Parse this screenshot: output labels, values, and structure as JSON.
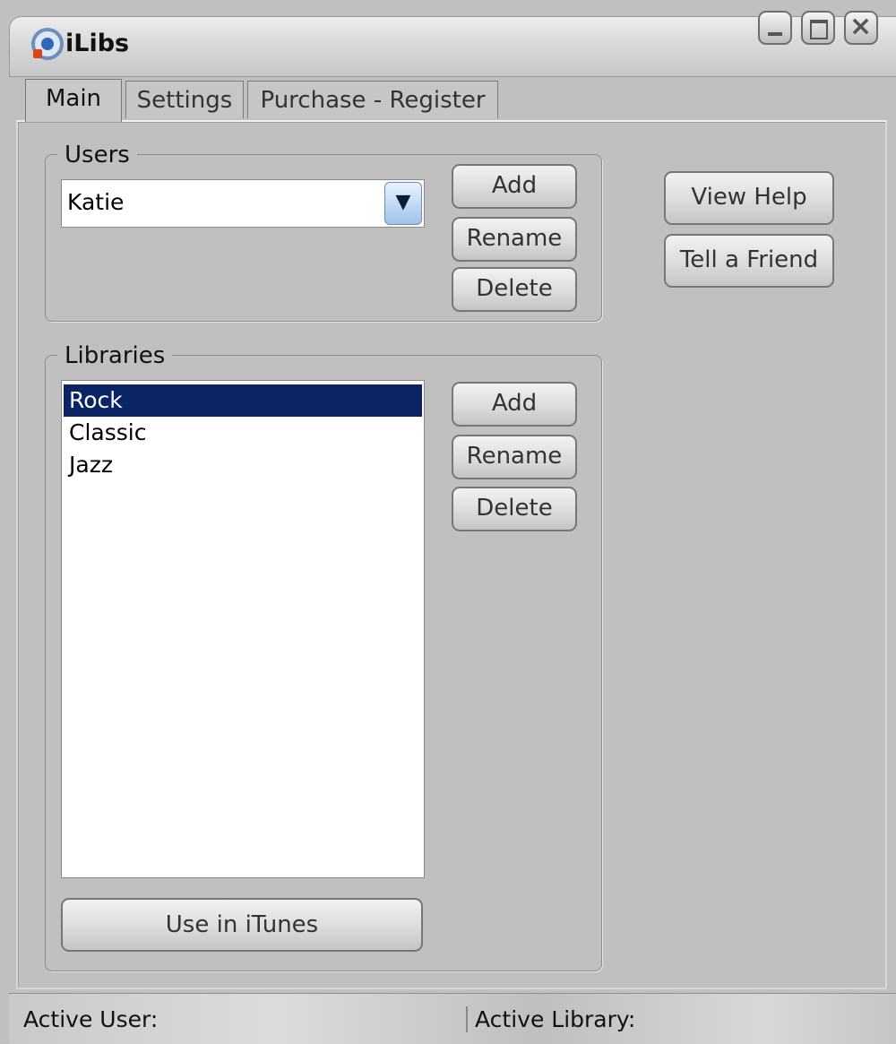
{
  "window": {
    "title": "iLibs",
    "controls": [
      "minimize",
      "maximize",
      "close"
    ]
  },
  "tabs": [
    {
      "label": "Main",
      "active": true
    },
    {
      "label": "Settings",
      "active": false
    },
    {
      "label": "Purchase - Register",
      "active": false
    }
  ],
  "users": {
    "group_label": "Users",
    "selected": "Katie",
    "buttons": {
      "add": "Add",
      "rename": "Rename",
      "delete": "Delete"
    }
  },
  "libraries": {
    "group_label": "Libraries",
    "items": [
      "Rock",
      "Classic",
      "Jazz"
    ],
    "selected_index": 0,
    "buttons": {
      "add": "Add",
      "rename": "Rename",
      "delete": "Delete"
    },
    "use_in_itunes": "Use in iTunes"
  },
  "side_buttons": {
    "view_help": "View Help",
    "tell_a_friend": "Tell a Friend"
  },
  "status": {
    "active_user": "Active User:",
    "active_library": "Active Library:"
  },
  "colors": {
    "selection": "#0a2465",
    "combo_arrow": "#9ec3ea"
  },
  "icons": {
    "app": "ilibs-app-icon",
    "combo": "triangle-down-icon"
  }
}
